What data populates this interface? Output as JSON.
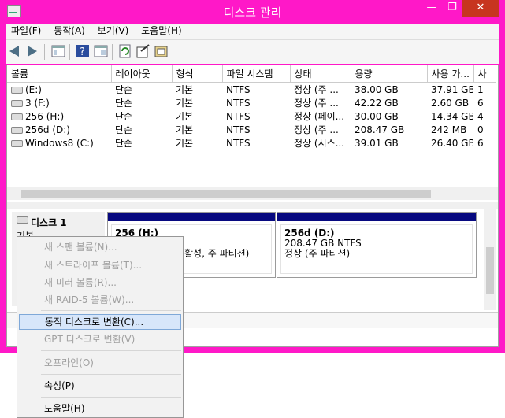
{
  "window": {
    "title": "디스크 관리",
    "minimize": "—",
    "maximize": "❐",
    "close": "✕"
  },
  "menu": [
    "파일(F)",
    "동작(A)",
    "보기(V)",
    "도움말(H)"
  ],
  "volumes": {
    "columns": [
      "볼륨",
      "레이아웃",
      "형식",
      "파일 시스템",
      "상태",
      "용량",
      "사용 가...",
      "사"
    ],
    "rows": [
      [
        "(E:)",
        "단순",
        "기본",
        "NTFS",
        "정상 (주 ...",
        "38.00 GB",
        "37.91 GB",
        "1"
      ],
      [
        "3 (F:)",
        "단순",
        "기본",
        "NTFS",
        "정상 (주 ...",
        "42.22 GB",
        "2.60 GB",
        "6"
      ],
      [
        "256 (H:)",
        "단순",
        "기본",
        "NTFS",
        "정상 (페이...",
        "30.00 GB",
        "14.34 GB",
        "4"
      ],
      [
        "256d (D:)",
        "단순",
        "기본",
        "NTFS",
        "정상 (주 ...",
        "208.47 GB",
        "242 MB",
        "0"
      ],
      [
        "Windows8 (C:)",
        "단순",
        "기본",
        "NTFS",
        "정상 (시스...",
        "39.01 GB",
        "26.40 GB",
        "6"
      ]
    ]
  },
  "disk": {
    "name": "디스크 1",
    "type": "기본",
    "partitions": [
      {
        "name": "256  (H:)",
        "line2": "활성, 주 파티션)"
      },
      {
        "name": "256d  (D:)",
        "line1": "208.47 GB NTFS",
        "line2": "정상 (주 파티션)"
      }
    ]
  },
  "context_menu": [
    {
      "label": "새 스팬 볼륨(N)...",
      "enabled": false
    },
    {
      "label": "새 스트라이프 볼륨(T)...",
      "enabled": false
    },
    {
      "label": "새 미러 볼륨(R)...",
      "enabled": false
    },
    {
      "label": "새 RAID-5 볼륨(W)...",
      "enabled": false
    },
    {
      "label": "동적 디스크로 변환(C)...",
      "enabled": true,
      "highlighted": true
    },
    {
      "label": "GPT 디스크로 변환(V)",
      "enabled": false
    },
    {
      "label": "오프라인(O)",
      "enabled": false
    },
    {
      "label": "속성(P)",
      "enabled": true
    },
    {
      "label": "도움말(H)",
      "enabled": true
    }
  ],
  "colors": {
    "frame": "#ff18c8",
    "partition_bar": "#070980",
    "highlight": "#d7e6fa"
  }
}
